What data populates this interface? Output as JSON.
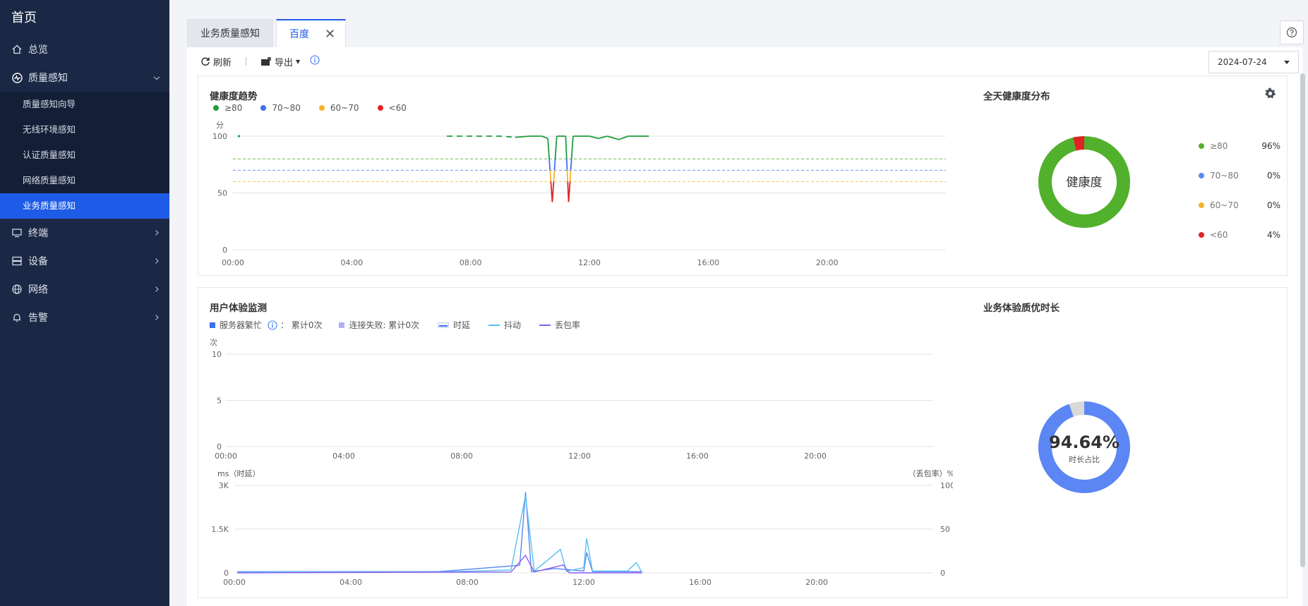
{
  "sidebar": {
    "home": "首页",
    "items": [
      {
        "label": "总览",
        "icon": "home-icon"
      },
      {
        "label": "质量感知",
        "icon": "pulse-icon",
        "expanded": true,
        "children": [
          "质量感知向导",
          "无线环境感知",
          "认证质量感知",
          "网络质量感知",
          "业务质量感知"
        ],
        "active_child": "业务质量感知"
      },
      {
        "label": "终端",
        "icon": "monitor-icon"
      },
      {
        "label": "设备",
        "icon": "server-icon"
      },
      {
        "label": "网络",
        "icon": "globe-icon"
      },
      {
        "label": "告警",
        "icon": "bell-icon"
      }
    ]
  },
  "tabs": [
    {
      "label": "业务质量感知",
      "active": false
    },
    {
      "label": "百度",
      "active": true
    }
  ],
  "toolbar": {
    "refresh_label": "刷新",
    "export_label": "导出",
    "date_value": "2024-07-24"
  },
  "colors": {
    "accent": "#1e5be6",
    "green": "#52b12c",
    "blue": "#5b86f3",
    "orange": "#f6b22b",
    "red": "#e02424",
    "cyan": "#58c0f0",
    "purple": "#8a5cf0",
    "lavender": "#b2aef5",
    "grey": "#d9d9d9"
  },
  "health_trend": {
    "title": "健康度趋势",
    "legend": [
      "≥80",
      "70~80",
      "60~70",
      "<60"
    ],
    "y_unit": "分"
  },
  "health_dist": {
    "title": "全天健康度分布",
    "center_label": "健康度",
    "rows": [
      {
        "label": "≥80",
        "value": "96%"
      },
      {
        "label": "70~80",
        "value": "0%"
      },
      {
        "label": "60~70",
        "value": "0%"
      },
      {
        "label": "<60",
        "value": "4%"
      }
    ]
  },
  "ux_monitor": {
    "title": "用户体验监测",
    "legend_busy": "服务器繁忙",
    "legend_busy_count": "：  累计0次",
    "legend_fail": "连接失败:  累计0次",
    "legend_latency": "时延",
    "legend_jitter": "抖动",
    "legend_loss": "丢包率",
    "count_unit": "次",
    "latency_unit": "ms（时延）",
    "loss_unit": "（丢包率）%"
  },
  "quality_time": {
    "title": "业务体验质优时长",
    "percent": "94.64%",
    "sub": "时长占比"
  },
  "chart_data": [
    {
      "type": "line",
      "title": "健康度趋势",
      "ylabel": "分",
      "ylim": [
        0,
        100
      ],
      "yticks": [
        0,
        50,
        100
      ],
      "xticks": [
        "00:00",
        "04:00",
        "08:00",
        "12:00",
        "16:00",
        "20:00"
      ],
      "thresholds": [
        80,
        70,
        60
      ],
      "series": [
        {
          "name": "健康度",
          "points": [
            [
              0.2,
              100
            ],
            [
              7.2,
              100
            ],
            [
              7.5,
              100
            ],
            [
              8.0,
              100
            ],
            [
              8.5,
              100
            ],
            [
              9.0,
              100
            ],
            [
              9.5,
              99
            ],
            [
              10.0,
              100
            ],
            [
              10.4,
              100
            ],
            [
              10.6,
              98
            ],
            [
              10.75,
              42
            ],
            [
              10.9,
              100
            ],
            [
              11.2,
              100
            ],
            [
              11.3,
              42
            ],
            [
              11.45,
              100
            ],
            [
              12.0,
              100
            ],
            [
              12.3,
              98
            ],
            [
              12.6,
              100
            ],
            [
              13.0,
              97
            ],
            [
              13.3,
              100
            ],
            [
              13.8,
              100
            ],
            [
              14.0,
              100
            ]
          ]
        }
      ]
    },
    {
      "type": "pie",
      "title": "全天健康度分布",
      "categories": [
        "≥80",
        "70~80",
        "60~70",
        "<60"
      ],
      "values": [
        96,
        0,
        0,
        4
      ]
    },
    {
      "type": "bar",
      "title": "用户体验监测",
      "ylabel": "次",
      "ylim": [
        0,
        10
      ],
      "yticks": [
        0,
        5,
        10
      ],
      "xticks": [
        "00:00",
        "04:00",
        "08:00",
        "12:00",
        "16:00",
        "20:00"
      ],
      "series": [
        {
          "name": "服务器繁忙",
          "values": []
        },
        {
          "name": "连接失败",
          "values": []
        }
      ]
    },
    {
      "type": "line",
      "ylabel": "ms（时延）",
      "y2label": "（丢包率）%",
      "ylim": [
        0,
        3000
      ],
      "yticks": [
        "0",
        "1.5K",
        "3K"
      ],
      "y2lim": [
        0,
        100
      ],
      "y2ticks": [
        0,
        50,
        100
      ],
      "xticks": [
        "00:00",
        "04:00",
        "08:00",
        "12:00",
        "16:00",
        "20:00"
      ],
      "series": [
        {
          "name": "时延",
          "points": [
            [
              0.1,
              40
            ],
            [
              7.0,
              40
            ],
            [
              9.8,
              260
            ],
            [
              10.0,
              2770
            ],
            [
              10.2,
              40
            ],
            [
              11.0,
              150
            ],
            [
              12.0,
              60
            ],
            [
              12.1,
              700
            ],
            [
              12.3,
              40
            ],
            [
              14.0,
              40
            ]
          ]
        },
        {
          "name": "抖动",
          "points": [
            [
              0.1,
              30
            ],
            [
              7.0,
              30
            ],
            [
              9.5,
              100
            ],
            [
              10.0,
              2650
            ],
            [
              10.3,
              60
            ],
            [
              11.2,
              800
            ],
            [
              11.4,
              50
            ],
            [
              12.0,
              180
            ],
            [
              12.1,
              1180
            ],
            [
              12.3,
              60
            ],
            [
              13.5,
              60
            ],
            [
              13.8,
              350
            ],
            [
              14.0,
              20
            ]
          ]
        },
        {
          "name": "丢包率",
          "points": [
            [
              0.1,
              0
            ],
            [
              9.5,
              1
            ],
            [
              10.0,
              20
            ],
            [
              10.3,
              1
            ],
            [
              11.3,
              9
            ],
            [
              11.5,
              0
            ],
            [
              14.0,
              0
            ]
          ]
        }
      ]
    },
    {
      "type": "pie",
      "title": "业务体验质优时长",
      "values": [
        94.64,
        5.36
      ]
    }
  ]
}
